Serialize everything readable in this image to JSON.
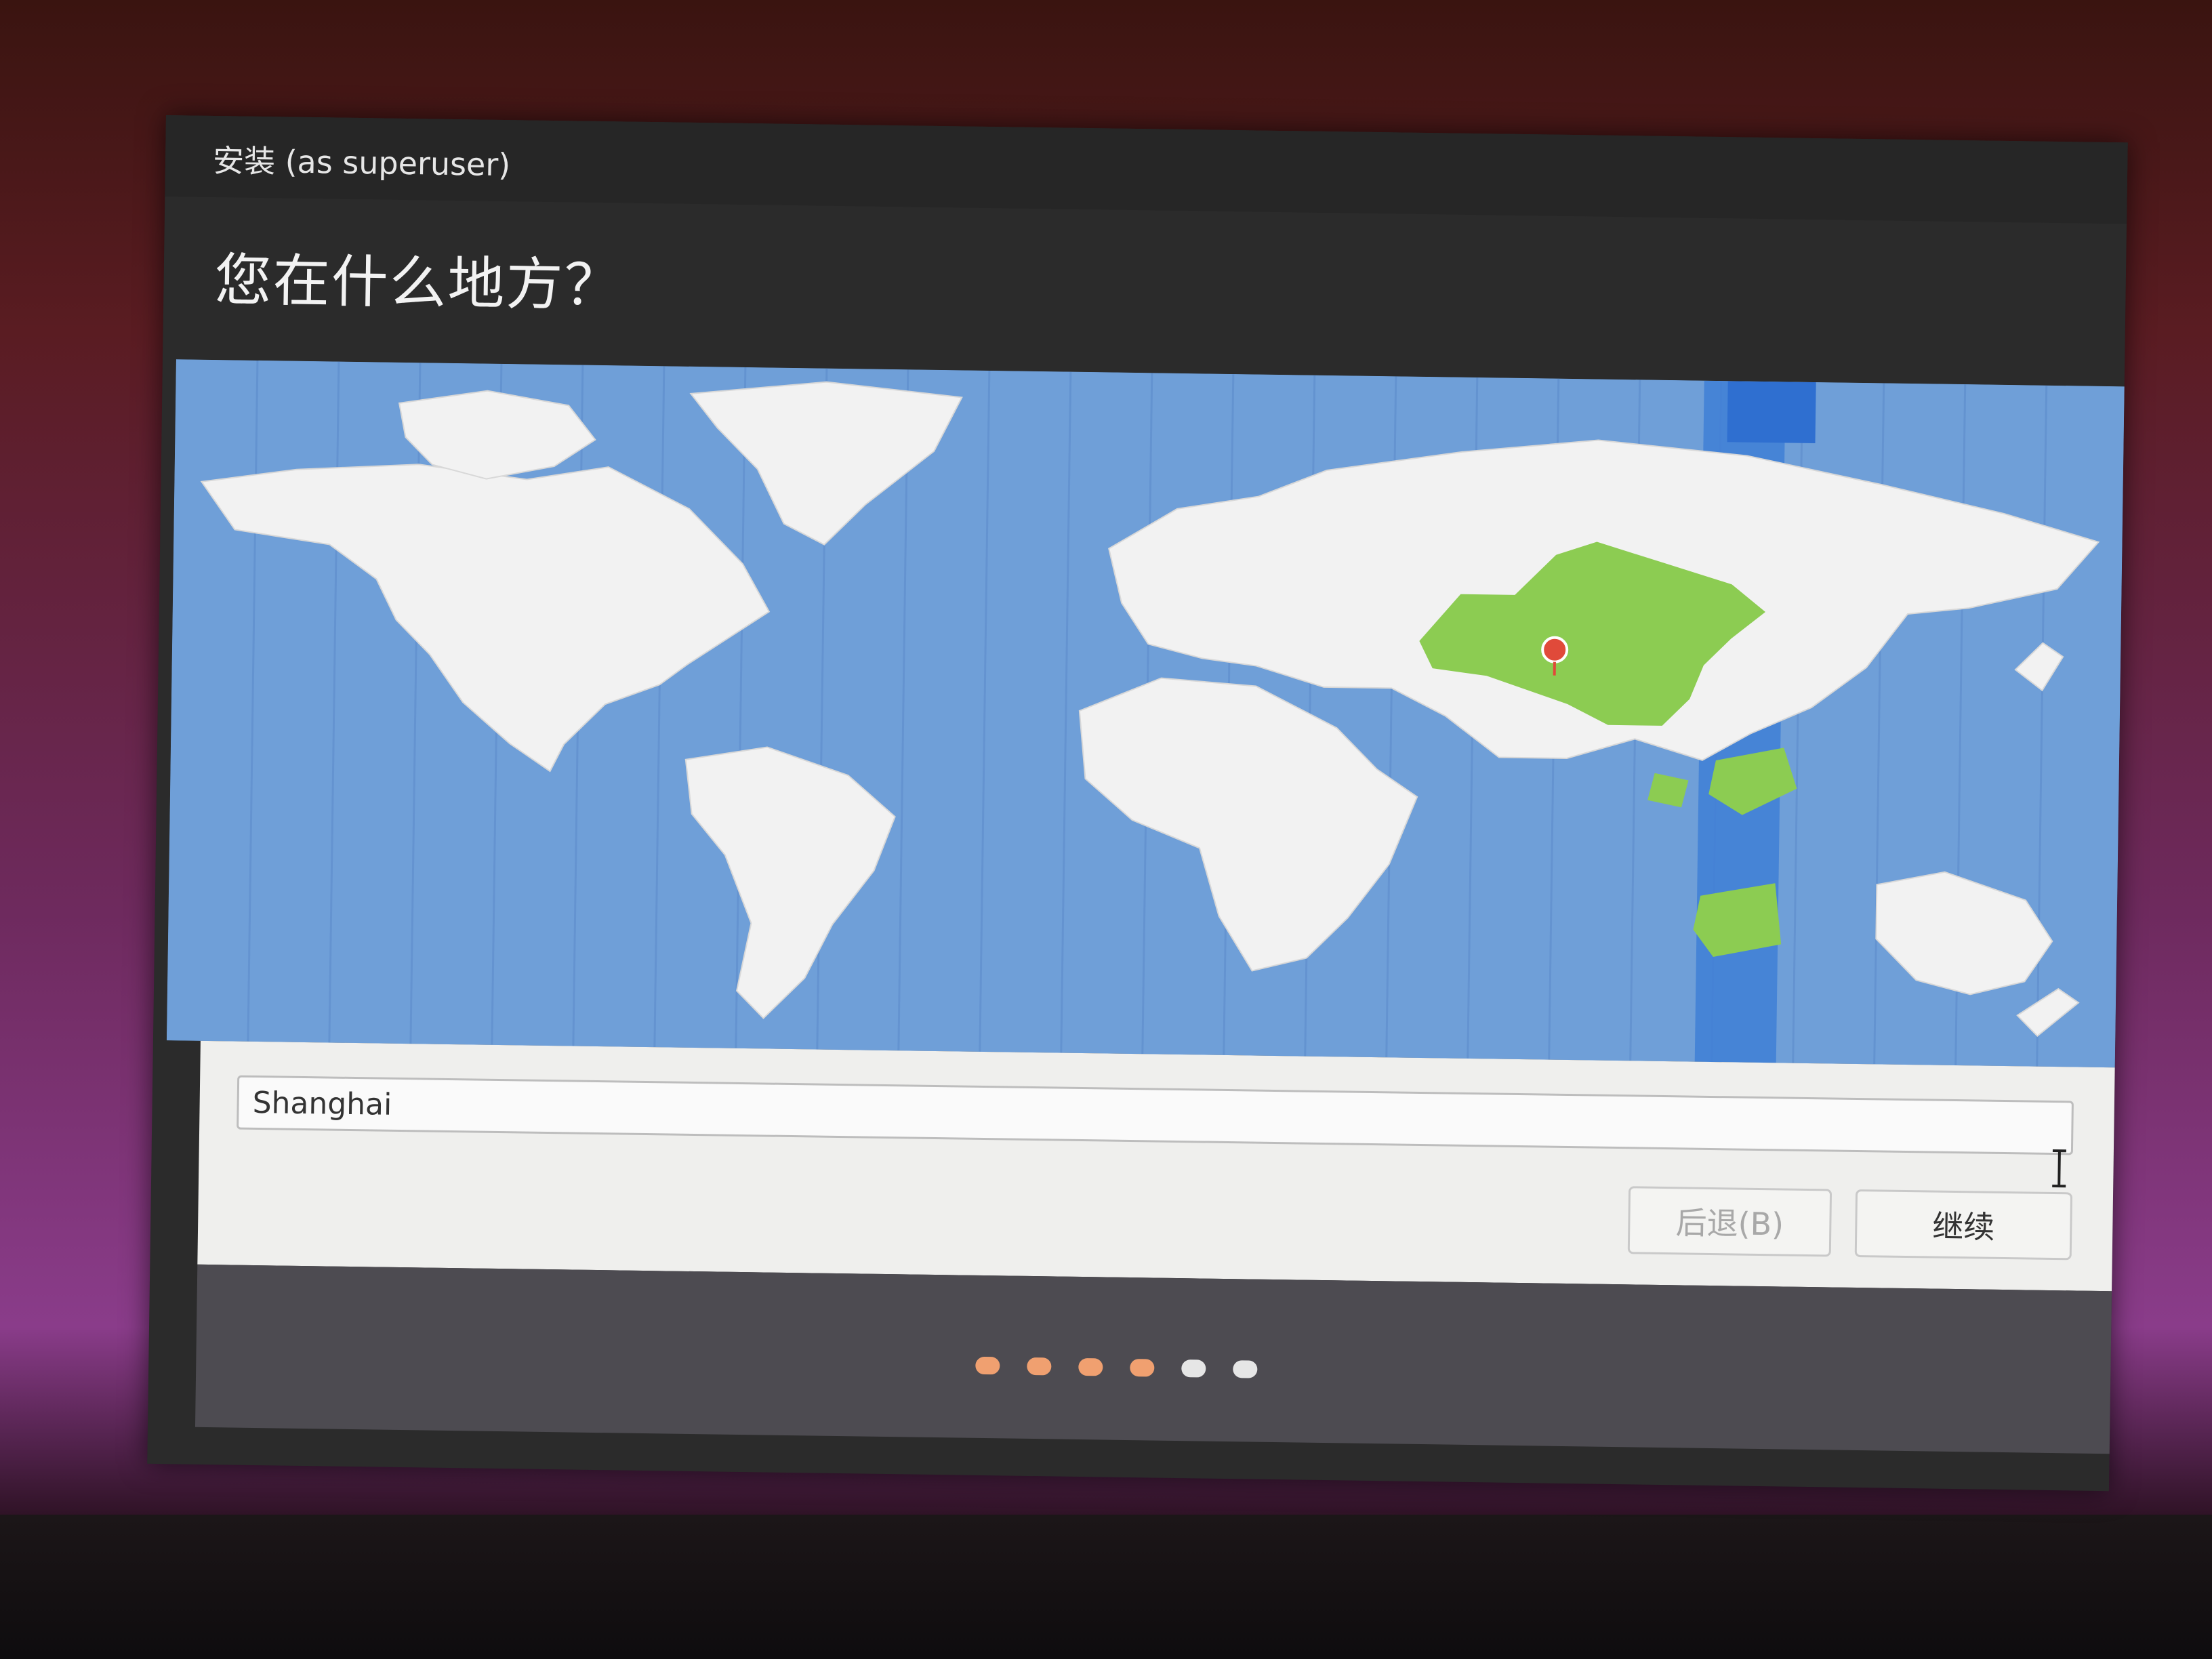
{
  "window": {
    "title": "安装 (as superuser)"
  },
  "page": {
    "heading": "您在什么地方？"
  },
  "location": {
    "value": "Shanghai"
  },
  "buttons": {
    "back": "后退(B)",
    "continue": "继续"
  },
  "progress": {
    "steps": [
      {
        "state": "done",
        "color": "#f0a070"
      },
      {
        "state": "done",
        "color": "#f0a070"
      },
      {
        "state": "done",
        "color": "#f0a070"
      },
      {
        "state": "done",
        "color": "#f0a070"
      },
      {
        "state": "pending",
        "color": "#e6e6e6"
      },
      {
        "state": "pending",
        "color": "#e6e6e6"
      }
    ]
  },
  "colors": {
    "ocean": "#6f9fd8",
    "land": "#f2f2f2",
    "selected_timezone_land": "#8ccc52",
    "selected_timezone_band": "#3f7fd6",
    "marker": "#e04a3a"
  }
}
